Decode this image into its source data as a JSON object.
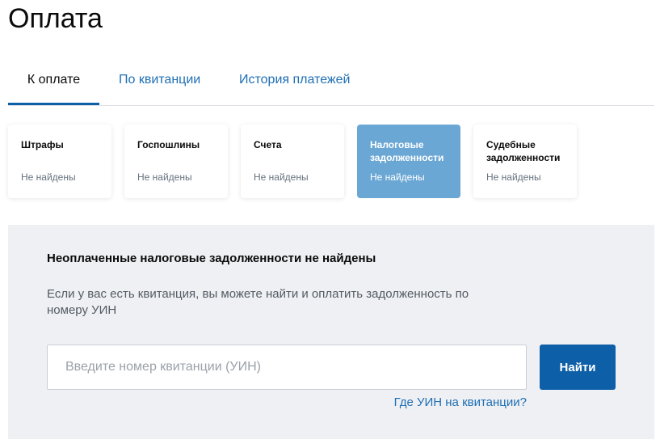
{
  "page": {
    "title": "Оплата"
  },
  "tabs": [
    {
      "label": "К оплате",
      "active": true
    },
    {
      "label": "По квитанции",
      "active": false
    },
    {
      "label": "История платежей",
      "active": false
    }
  ],
  "categories": [
    {
      "title": "Штрафы",
      "status": "Не найдены",
      "selected": false
    },
    {
      "title": "Госпошлины",
      "status": "Не найдены",
      "selected": false
    },
    {
      "title": "Счета",
      "status": "Не найдены",
      "selected": false
    },
    {
      "title": "Налоговые задолженности",
      "status": "Не найдены",
      "selected": true
    },
    {
      "title": "Судебные задолженности",
      "status": "Не найдены",
      "selected": false
    }
  ],
  "panel": {
    "heading": "Неоплаченные налоговые задолженности не найдены",
    "description": "Если у вас есть квитанция, вы можете найти и оплатить задолженность по номеру УИН",
    "input_placeholder": "Введите номер квитанции (УИН)",
    "input_value": "",
    "button_label": "Найти",
    "help_link": "Где УИН на квитанции?"
  },
  "colors": {
    "accent": "#0d5fa8",
    "link": "#1f6fb4",
    "selected_card": "#6ba7d4",
    "panel_background": "#eff0f4"
  }
}
